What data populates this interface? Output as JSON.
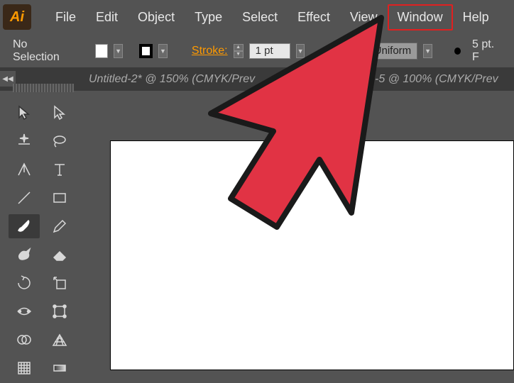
{
  "app": {
    "logo": "Ai"
  },
  "menu": {
    "file": "File",
    "edit": "Edit",
    "object": "Object",
    "type": "Type",
    "select": "Select",
    "effect": "Effect",
    "view": "View",
    "window": "Window",
    "help": "Help"
  },
  "control": {
    "selection": "No Selection",
    "stroke_label": "Stroke:",
    "stroke_value": "1 pt",
    "profile": "Uniform",
    "brush_size": "5 pt. F"
  },
  "tabs": {
    "tab1": "Untitled-2* @ 150% (CMYK/Prev",
    "tab2": "d-5 @ 100% (CMYK/Prev"
  },
  "tools": {
    "selection": "selection",
    "direct_selection": "direct-selection",
    "magic_wand": "magic-wand",
    "lasso": "lasso",
    "pen": "pen",
    "type": "type",
    "line": "line",
    "rectangle": "rectangle",
    "paintbrush": "paintbrush",
    "pencil": "pencil",
    "blob_brush": "blob-brush",
    "eraser": "eraser",
    "rotate": "rotate",
    "scale": "scale",
    "width": "width",
    "free_transform": "free-transform",
    "shape_builder": "shape-builder",
    "perspective": "perspective",
    "mesh": "mesh",
    "gradient": "gradient"
  }
}
